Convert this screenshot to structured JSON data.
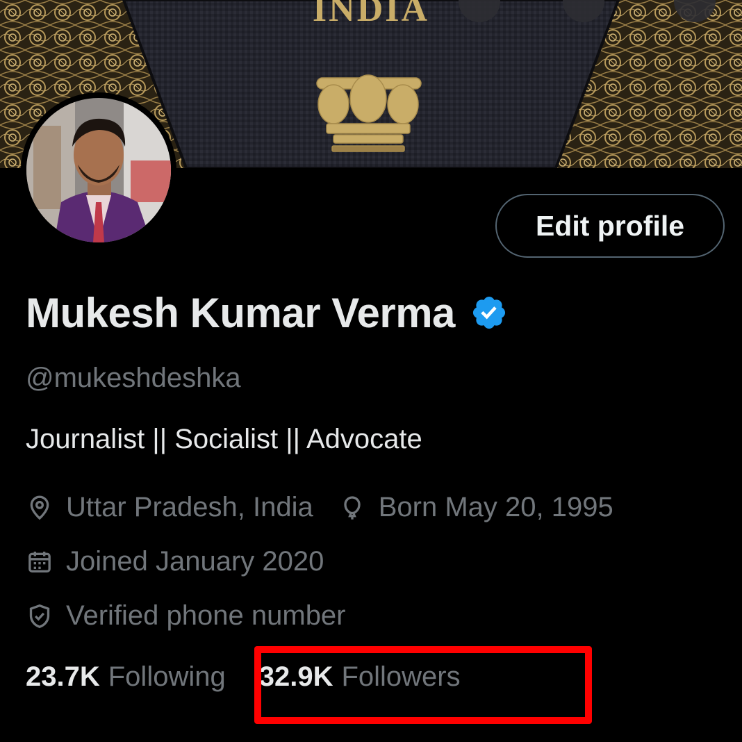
{
  "banner": {
    "title": "INDIA"
  },
  "profile": {
    "display_name": "Mukesh Kumar Verma",
    "handle": "@mukeshdeshka",
    "bio": "Journalist || Socialist || Advocate",
    "location": "Uttar Pradesh, India",
    "born": "Born May 20, 1995",
    "joined": "Joined January 2020",
    "verified_phone": "Verified phone number"
  },
  "actions": {
    "edit_profile_label": "Edit profile"
  },
  "stats": {
    "following_count": "23.7K",
    "following_label": "Following",
    "followers_count": "32.9K",
    "followers_label": "Followers"
  },
  "colors": {
    "background": "#000000",
    "primary_text": "#e7e9ea",
    "secondary_text": "#71767b",
    "verified_blue": "#1d9bf0",
    "annotation_red": "#ff0000",
    "banner_gold": "#c9ad68"
  },
  "icons": {
    "location": "location-pin-icon",
    "born": "balloon-icon",
    "joined": "calendar-icon",
    "verified_phone": "shield-check-icon",
    "verified_badge": "verified-badge-icon"
  }
}
